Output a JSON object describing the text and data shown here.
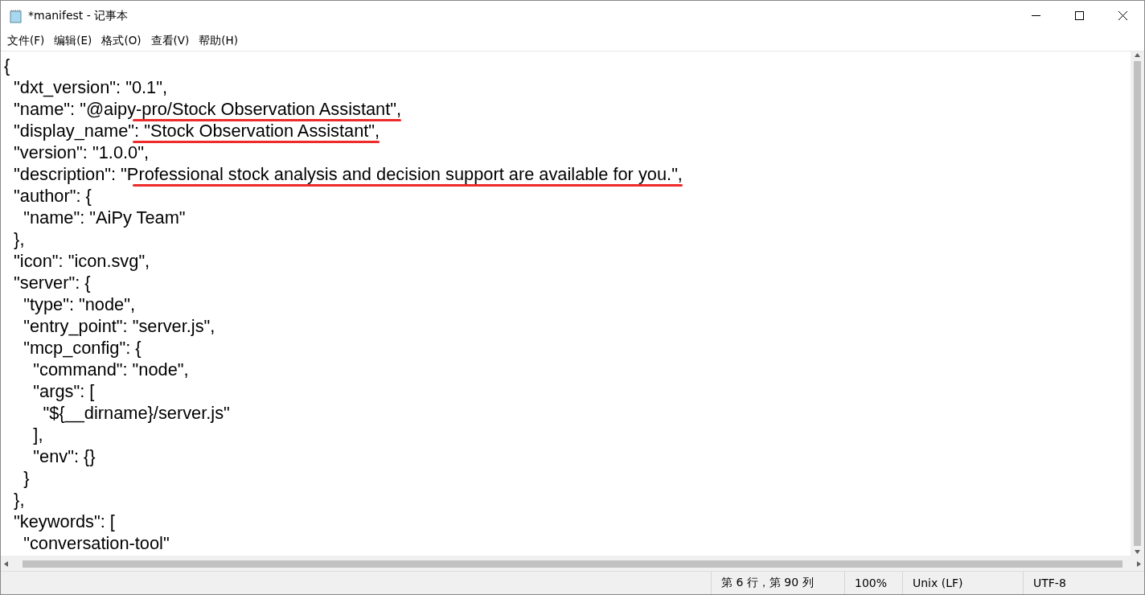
{
  "window": {
    "title": "*manifest - 记事本"
  },
  "menu": [
    "文件(F)",
    "编辑(E)",
    "格式(O)",
    "查看(V)",
    "帮助(H)"
  ],
  "editor": {
    "lines": [
      {
        "text": "{",
        "underlined": false
      },
      {
        "text": "  \"dxt_version\": \"0.1\",",
        "underlined": false
      },
      {
        "text": "  \"name\": \"@aipy-pro/Stock Observation Assistant\",",
        "underlined": true
      },
      {
        "text": "  \"display_name\": \"Stock Observation Assistant\",",
        "underlined": true
      },
      {
        "text": "  \"version\": \"1.0.0\",",
        "underlined": false
      },
      {
        "text": "  \"description\": \"Professional stock analysis and decision support are available for you.\",",
        "underlined": true
      },
      {
        "text": "  \"author\": {",
        "underlined": false
      },
      {
        "text": "    \"name\": \"AiPy Team\"",
        "underlined": false
      },
      {
        "text": "  },",
        "underlined": false
      },
      {
        "text": "  \"icon\": \"icon.svg\",",
        "underlined": false
      },
      {
        "text": "  \"server\": {",
        "underlined": false
      },
      {
        "text": "    \"type\": \"node\",",
        "underlined": false
      },
      {
        "text": "    \"entry_point\": \"server.js\",",
        "underlined": false
      },
      {
        "text": "    \"mcp_config\": {",
        "underlined": false
      },
      {
        "text": "      \"command\": \"node\",",
        "underlined": false
      },
      {
        "text": "      \"args\": [",
        "underlined": false
      },
      {
        "text": "        \"${__dirname}/server.js\"",
        "underlined": false
      },
      {
        "text": "      ],",
        "underlined": false
      },
      {
        "text": "      \"env\": {}",
        "underlined": false
      },
      {
        "text": "    }",
        "underlined": false
      },
      {
        "text": "  },",
        "underlined": false
      },
      {
        "text": "  \"keywords\": [",
        "underlined": false
      },
      {
        "text": "    \"conversation-tool\"",
        "underlined": false
      }
    ]
  },
  "status_bar": {
    "position": "第 6 行，第 90 列",
    "zoom": "100%",
    "line_ending": "Unix (LF)",
    "encoding": "UTF-8"
  }
}
